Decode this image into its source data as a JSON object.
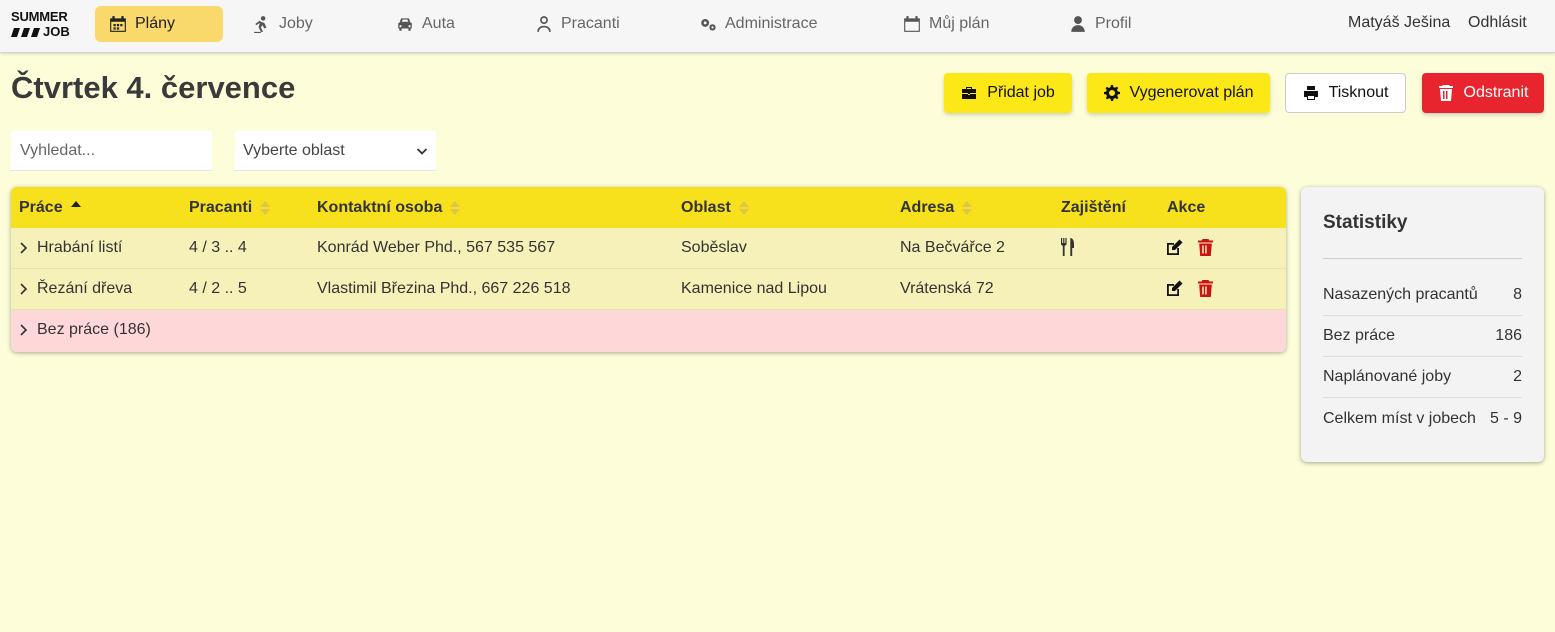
{
  "logo": {
    "line1": "SUMMER",
    "line2": "JOB"
  },
  "nav": {
    "items": [
      {
        "label": "Plány",
        "icon": "calendar-icon",
        "active": true
      },
      {
        "label": "Joby",
        "icon": "worker-icon"
      },
      {
        "label": "Auta",
        "icon": "car-icon"
      },
      {
        "label": "Pracanti",
        "icon": "user-outline-icon"
      },
      {
        "label": "Administrace",
        "icon": "gears-icon"
      },
      {
        "label": "Můj plán",
        "icon": "calendar-icon"
      },
      {
        "label": "Profil",
        "icon": "user-icon"
      }
    ],
    "user_name": "Matyáš Ješina",
    "logout": "Odhlásit"
  },
  "header": {
    "title": "Čtvrtek 4. července"
  },
  "toolbar": {
    "add_job": "Přidat job",
    "generate_plan": "Vygenerovat plán",
    "print": "Tisknout",
    "delete": "Odstranit"
  },
  "filters": {
    "search_placeholder": "Vyhledat...",
    "area_select": "Vyberte oblast"
  },
  "table": {
    "columns": [
      "Práce",
      "Pracanti",
      "Kontaktní osoba",
      "Oblast",
      "Adresa",
      "Zajištění",
      "Akce"
    ],
    "rows": [
      {
        "job": "Hrabání listí",
        "workers": "4 / 3 .. 4",
        "contact": "Konrád Weber Phd., 567 535 567",
        "area": "Soběslav",
        "address": "Na Bečvářce 2",
        "provision_icon": "food-icon"
      },
      {
        "job": "Řezání dřeva",
        "workers": "4 / 2 .. 5",
        "contact": "Vlastimil Březina Phd., 667 226 518",
        "area": "Kamenice nad Lipou",
        "address": "Vrátenská 72"
      }
    ],
    "unassigned": "Bez práce (186)"
  },
  "stats": {
    "title": "Statistiky",
    "rows": [
      {
        "label": "Nasazených pracantů",
        "value": "8"
      },
      {
        "label": "Bez práce",
        "value": "186"
      },
      {
        "label": "Naplánované joby",
        "value": "2"
      },
      {
        "label": "Celkem míst v jobech",
        "value": "5 - 9"
      }
    ]
  },
  "colors": {
    "background": "#fdfed9",
    "accent": "#fce816",
    "danger": "#e8242e",
    "nav_active": "#f9d96b"
  }
}
